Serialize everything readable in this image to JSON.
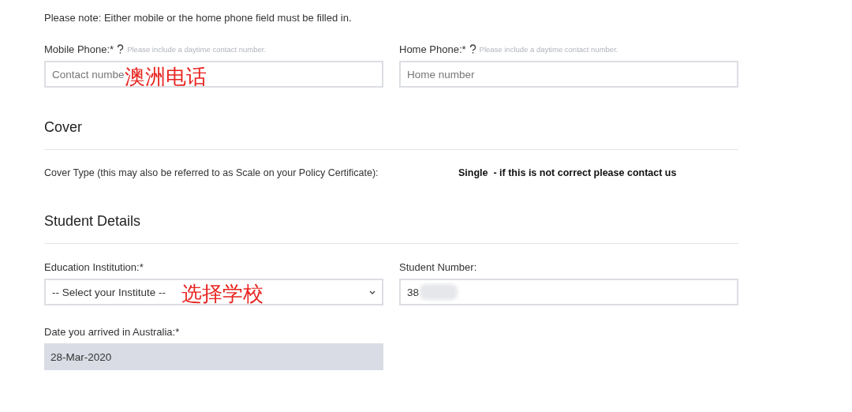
{
  "note": "Please note: Either mobile or the home phone field must be filled in.",
  "phone_fields": [
    {
      "label": "Mobile Phone:*",
      "hint": "Please include a daytime contact number.",
      "placeholder": "Contact numbe",
      "annotation": "澳洲电话"
    },
    {
      "label": "Home Phone:*",
      "hint": "Please include a daytime contact number.",
      "placeholder": "Home number"
    }
  ],
  "cover": {
    "heading": "Cover",
    "label": "Cover Type (this may also be referred to as Scale on your Policy Certificate):",
    "value": "Single  - if this is not correct please contact us"
  },
  "student_details": {
    "heading": "Student Details",
    "institution": {
      "label": "Education Institution:*",
      "value": "-- Select your Institute --",
      "annotation": "选择学校"
    },
    "student_number": {
      "label": "Student Number:",
      "value": "38"
    },
    "arrival_date": {
      "label": "Date you arrived in Australia:*",
      "value": "28-Mar-2020"
    }
  }
}
